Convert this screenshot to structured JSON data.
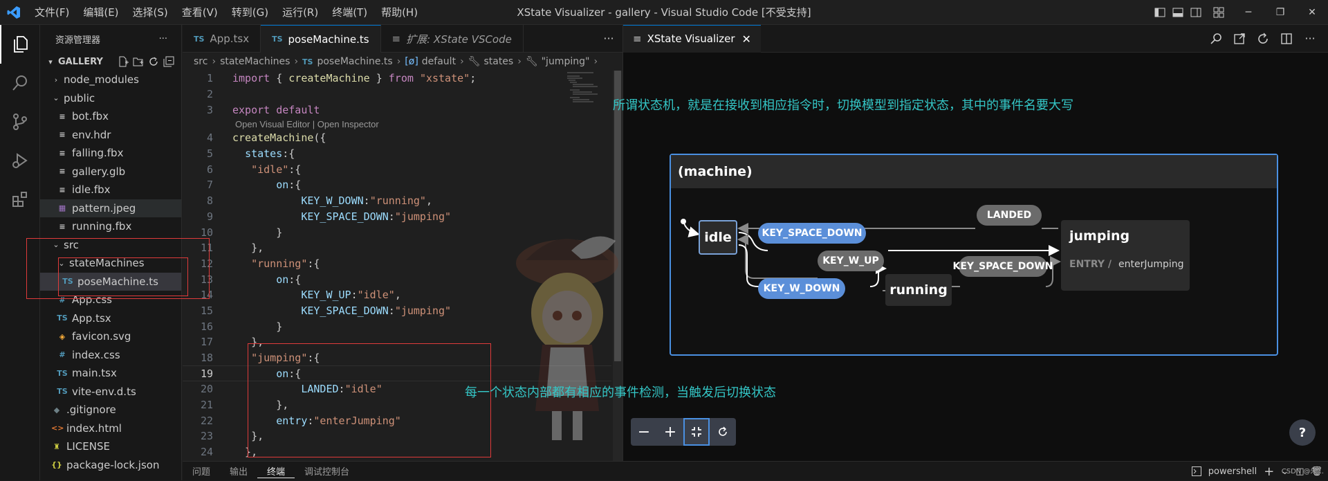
{
  "titlebar": {
    "menu": [
      "文件(F)",
      "编辑(E)",
      "选择(S)",
      "查看(V)",
      "转到(G)",
      "运行(R)",
      "终端(T)",
      "帮助(H)"
    ],
    "title": "XState Visualizer - gallery - Visual Studio Code [不受支持]"
  },
  "sidebar": {
    "header": "资源管理器",
    "more": "···",
    "section": "GALLERY",
    "tree": [
      {
        "label": "node_modules",
        "indent": 1,
        "kind": "folder",
        "expanded": false
      },
      {
        "label": "public",
        "indent": 1,
        "kind": "folder",
        "expanded": true
      },
      {
        "label": "bot.fbx",
        "indent": 2,
        "kind": "file",
        "icon": "lines"
      },
      {
        "label": "env.hdr",
        "indent": 2,
        "kind": "file",
        "icon": "lines"
      },
      {
        "label": "falling.fbx",
        "indent": 2,
        "kind": "file",
        "icon": "lines"
      },
      {
        "label": "gallery.glb",
        "indent": 2,
        "kind": "file",
        "icon": "lines"
      },
      {
        "label": "idle.fbx",
        "indent": 2,
        "kind": "file",
        "icon": "lines"
      },
      {
        "label": "pattern.jpeg",
        "indent": 2,
        "kind": "file",
        "icon": "image",
        "hover": true
      },
      {
        "label": "running.fbx",
        "indent": 2,
        "kind": "file",
        "icon": "lines"
      },
      {
        "label": "src",
        "indent": 1,
        "kind": "folder",
        "expanded": true
      },
      {
        "label": "stateMachines",
        "indent": 2,
        "kind": "folder",
        "expanded": true
      },
      {
        "label": "poseMachine.ts",
        "indent": 3,
        "kind": "file",
        "icon": "TS",
        "selected": true
      },
      {
        "label": "App.css",
        "indent": 2,
        "kind": "file",
        "icon": "#"
      },
      {
        "label": "App.tsx",
        "indent": 2,
        "kind": "file",
        "icon": "TS"
      },
      {
        "label": "favicon.svg",
        "indent": 2,
        "kind": "file",
        "icon": "svg"
      },
      {
        "label": "index.css",
        "indent": 2,
        "kind": "file",
        "icon": "#"
      },
      {
        "label": "main.tsx",
        "indent": 2,
        "kind": "file",
        "icon": "TS"
      },
      {
        "label": "vite-env.d.ts",
        "indent": 2,
        "kind": "file",
        "icon": "TS"
      },
      {
        "label": ".gitignore",
        "indent": 1,
        "kind": "file",
        "icon": "git"
      },
      {
        "label": "index.html",
        "indent": 1,
        "kind": "file",
        "icon": "html"
      },
      {
        "label": "LICENSE",
        "indent": 1,
        "kind": "file",
        "icon": "license"
      },
      {
        "label": "package-lock.json",
        "indent": 1,
        "kind": "file",
        "icon": "json"
      }
    ]
  },
  "editor": {
    "tabs": [
      {
        "label": "App.tsx",
        "prefix": "TS",
        "active": false
      },
      {
        "label": "poseMachine.ts",
        "prefix": "TS",
        "active": true
      },
      {
        "label": "扩展: XState VSCode",
        "prefix": "≡",
        "active": false,
        "italic": true
      }
    ],
    "tabs_more": "···",
    "breadcrumb": [
      "src",
      "stateMachines",
      "poseMachine.ts",
      "default",
      "states",
      "\"jumping\""
    ],
    "codelens": "Open Visual Editor | Open Inspector",
    "current_line": 19,
    "lines": [
      {
        "n": "1",
        "text": "import { createMachine } from \"xstate\";"
      },
      {
        "n": "2",
        "text": ""
      },
      {
        "n": "3",
        "text": "export default"
      },
      {
        "n": "4",
        "text": "createMachine({"
      },
      {
        "n": "5",
        "text": "  states:{"
      },
      {
        "n": "6",
        "text": "   \"idle\":{"
      },
      {
        "n": "7",
        "text": "       on:{"
      },
      {
        "n": "8",
        "text": "           KEY_W_DOWN:\"running\","
      },
      {
        "n": "9",
        "text": "           KEY_SPACE_DOWN:\"jumping\""
      },
      {
        "n": "10",
        "text": "       }"
      },
      {
        "n": "11",
        "text": "   },"
      },
      {
        "n": "12",
        "text": "   \"running\":{"
      },
      {
        "n": "13",
        "text": "       on:{"
      },
      {
        "n": "14",
        "text": "           KEY_W_UP:\"idle\","
      },
      {
        "n": "15",
        "text": "           KEY_SPACE_DOWN:\"jumping\""
      },
      {
        "n": "16",
        "text": "       }"
      },
      {
        "n": "17",
        "text": "   },"
      },
      {
        "n": "18",
        "text": "   \"jumping\":{"
      },
      {
        "n": "19",
        "text": "       on:{"
      },
      {
        "n": "20",
        "text": "           LANDED:\"idle\""
      },
      {
        "n": "21",
        "text": "       },"
      },
      {
        "n": "22",
        "text": "       entry:\"enterJumping\""
      },
      {
        "n": "23",
        "text": "   },"
      },
      {
        "n": "24",
        "text": "  },"
      }
    ]
  },
  "panel": {
    "tabs": [
      "问题",
      "输出",
      "终端",
      "调试控制台"
    ],
    "active_tab": "终端",
    "shell": "powershell",
    "watermark": "CSDN @朱..."
  },
  "visualizer": {
    "tab": "XState Visualizer",
    "annotation_top": "所谓状态机，就是在接收到相应指令时，切换模型到指定状态，其中的事件名要大写",
    "annotation_mid": "每一个状态内部都有相应的事件检测，当触发后切换状态",
    "machine_title": "(machine)",
    "states": {
      "idle": "idle",
      "running": "running",
      "jumping": "jumping",
      "entry_label": "ENTRY /",
      "entry_action": "enterJumping"
    },
    "events": {
      "landed": "LANDED",
      "idle_space": "KEY_SPACE_DOWN",
      "w_up": "KEY_W_UP",
      "running_space": "KEY_SPACE_DOWN",
      "w_down": "KEY_W_DOWN"
    },
    "help": "?"
  },
  "colors": {
    "accent": "#0078d4",
    "annotation": "#34c6c6",
    "event_blue": "#5b8fd9",
    "event_gray": "#6b6b6b",
    "machine_border": "#4a90e2",
    "highlight_box": "#e03b3b"
  }
}
